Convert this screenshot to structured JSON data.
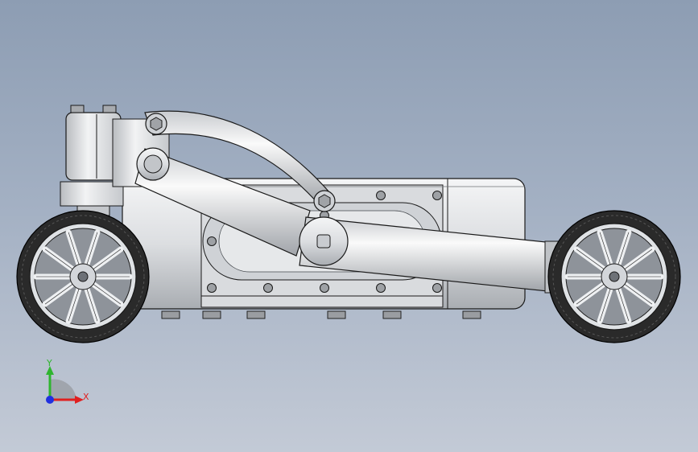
{
  "viewport": {
    "background_top": "#8d9db3",
    "background_bottom": "#c3cad6"
  },
  "model": {
    "part_color": "#e4e6e8",
    "edge_color": "#1a1a1a",
    "tire_color": "#2a2a2a",
    "components": [
      {
        "name": "front-wheel",
        "spokes": 10
      },
      {
        "name": "rear-wheel",
        "spokes": 10
      },
      {
        "name": "chassis-body",
        "visible_bolts": 12
      },
      {
        "name": "lift-arm"
      },
      {
        "name": "upper-link"
      },
      {
        "name": "suspension-tower"
      }
    ]
  },
  "triad": {
    "y_label": "Y",
    "x_label": "X",
    "y_color": "#2fb52f",
    "x_color": "#e02020",
    "z_color": "#2030e0"
  }
}
